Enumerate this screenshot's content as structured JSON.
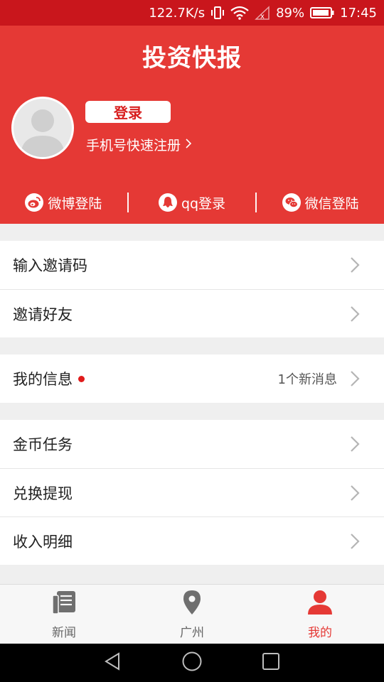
{
  "status_bar": {
    "speed": "122.7K/s",
    "battery_percent": "89%",
    "time": "17:45"
  },
  "header": {
    "title": "投资快报"
  },
  "profile": {
    "login_label": "登录",
    "register_label": "手机号快速注册",
    "social_logins": [
      {
        "icon": "weibo-icon",
        "label": "微博登陆"
      },
      {
        "icon": "qq-icon",
        "label": "qq登录"
      },
      {
        "icon": "wechat-icon",
        "label": "微信登陆"
      }
    ]
  },
  "menu": {
    "group1": [
      {
        "label": "输入邀请码"
      },
      {
        "label": "邀请好友"
      }
    ],
    "group2": [
      {
        "label": "我的信息",
        "extra": "1个新消息"
      }
    ],
    "group3": [
      {
        "label": "金币任务"
      },
      {
        "label": "兑换提现"
      },
      {
        "label": "收入明细"
      }
    ]
  },
  "tabs": [
    {
      "icon": "news-icon",
      "label": "新闻"
    },
    {
      "icon": "location-pin-icon",
      "label": "广州"
    },
    {
      "icon": "person-icon",
      "label": "我的"
    }
  ],
  "colors": {
    "primary": "#e53935",
    "status_bar": "#c9161c",
    "accent_dot": "#e01b1b"
  }
}
